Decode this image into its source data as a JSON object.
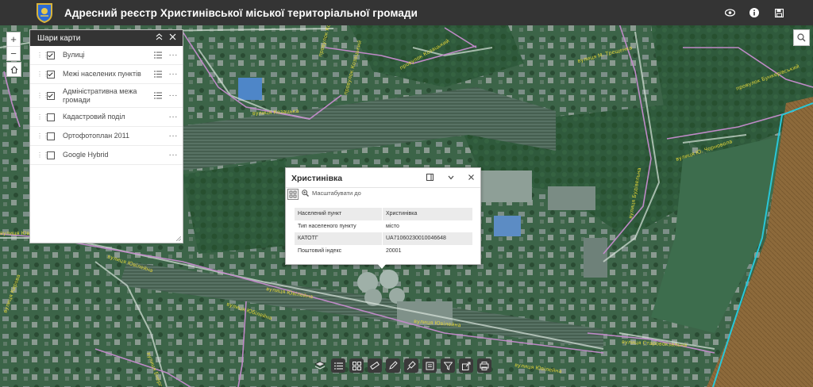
{
  "header": {
    "title": "Адресний реєстр Христинівської міської територіальної громади"
  },
  "layer_panel": {
    "title": "Шари карти",
    "layers": [
      {
        "label": "Вулиці",
        "checked": true,
        "legend": true
      },
      {
        "label": "Межі населених пунктів",
        "checked": true,
        "legend": true
      },
      {
        "label": "Адміністративна межа громади",
        "checked": true,
        "legend": true
      },
      {
        "label": "Кадастровий поділ",
        "checked": false,
        "legend": false
      },
      {
        "label": "Ортофотоплан 2011",
        "checked": false,
        "legend": false
      },
      {
        "label": "Google Hybrid",
        "checked": false,
        "legend": false
      }
    ]
  },
  "popup": {
    "title": "Христинівка",
    "zoom_to_label": "Масштабувати до",
    "fields": [
      {
        "key": "Населений пункт",
        "value": "Христинівка"
      },
      {
        "key": "Тип населеного пункту",
        "value": "місто"
      },
      {
        "key": "КАТОТГ",
        "value": "UA71060230010046648"
      },
      {
        "key": "Поштовий індекс",
        "value": "20001"
      }
    ]
  },
  "map": {
    "street_labels": [
      "провулок Козацький",
      "провулок Козацький",
      "вулиця Козацька",
      "провулок Козацький",
      "вулиця М. Трещенка",
      "провулок Бункерівський",
      "вулиця Ю. Чорновола",
      "вулиця Будівельна",
      "вулиця Ювілейна",
      "вулиця Ювілейна",
      "вулиця Ювілейна",
      "вулиця Юбілейна",
      "вулиця Ювілейна",
      "вулиця Енергетиків",
      "вулиця Ювілейна",
      "вулиця Кирова",
      "вулиця Старовокзальна"
    ],
    "colors": {
      "imagery": "#2f5a3f",
      "boundary": "#c08ac8",
      "admin_boundary": "#28c7d8",
      "street_label": "#e0d43a"
    }
  },
  "icons": {
    "header": [
      "eye-icon",
      "info-icon",
      "save-icon"
    ],
    "toolbar": [
      "layers-icon",
      "legend-icon",
      "basemap-gallery-icon",
      "measure-icon",
      "draw-icon",
      "edit-icon",
      "print-icon",
      "filter-icon",
      "share-icon",
      "export-icon"
    ]
  }
}
